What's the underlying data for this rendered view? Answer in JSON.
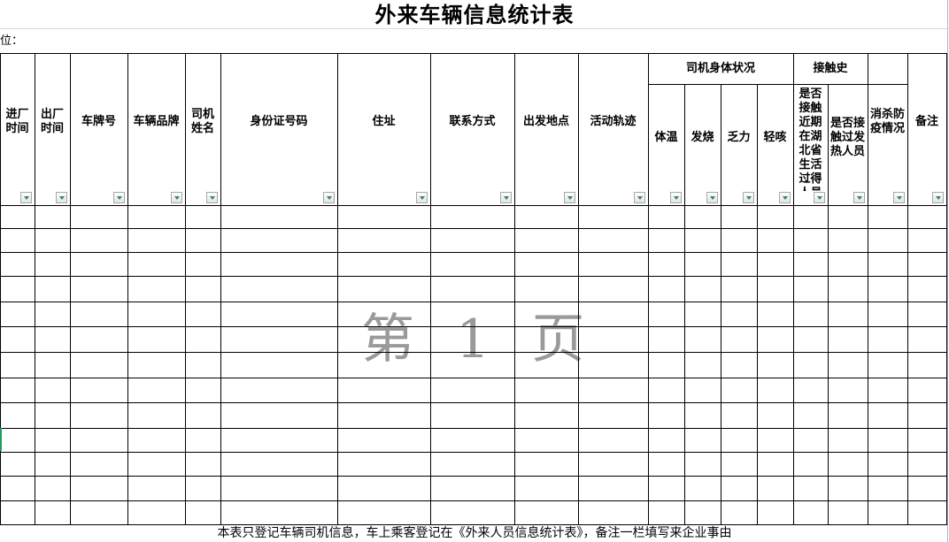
{
  "title": "外来车辆信息统计表",
  "unit_label": "位：",
  "watermark": "第 1 页",
  "groups": {
    "health": "司机身体状况",
    "contact": "接触史"
  },
  "columns": [
    "进厂时间",
    "出厂时间",
    "车牌号",
    "车辆品牌",
    "司机姓名",
    "身份证号码",
    "住址",
    "联系方式",
    "出发地点",
    "活动轨迹",
    "体温",
    "发烧",
    "乏力",
    "轻咳",
    "是否接触近期在湖北省生活过得人员",
    "是否接触过发热人员",
    "消杀防疫情况",
    "备注"
  ],
  "footnote": "本表只登记车辆司机信息，车上乘客登记在《外来人员信息统计表》，备注一栏填写来企业事由",
  "data_row_count": 13
}
